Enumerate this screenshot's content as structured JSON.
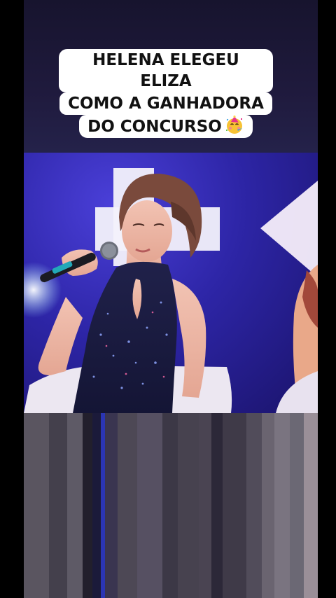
{
  "caption": {
    "line1": "HELENA ELEGEU ELIZA",
    "line2": "COMO A GANHADORA",
    "line3": "DO CONCURSO"
  },
  "icons": {
    "emoji": "partying-face-icon"
  },
  "colors": {
    "stage_blue": "#2d25a6",
    "caption_bg": "#ffffff",
    "caption_text": "#111111"
  }
}
